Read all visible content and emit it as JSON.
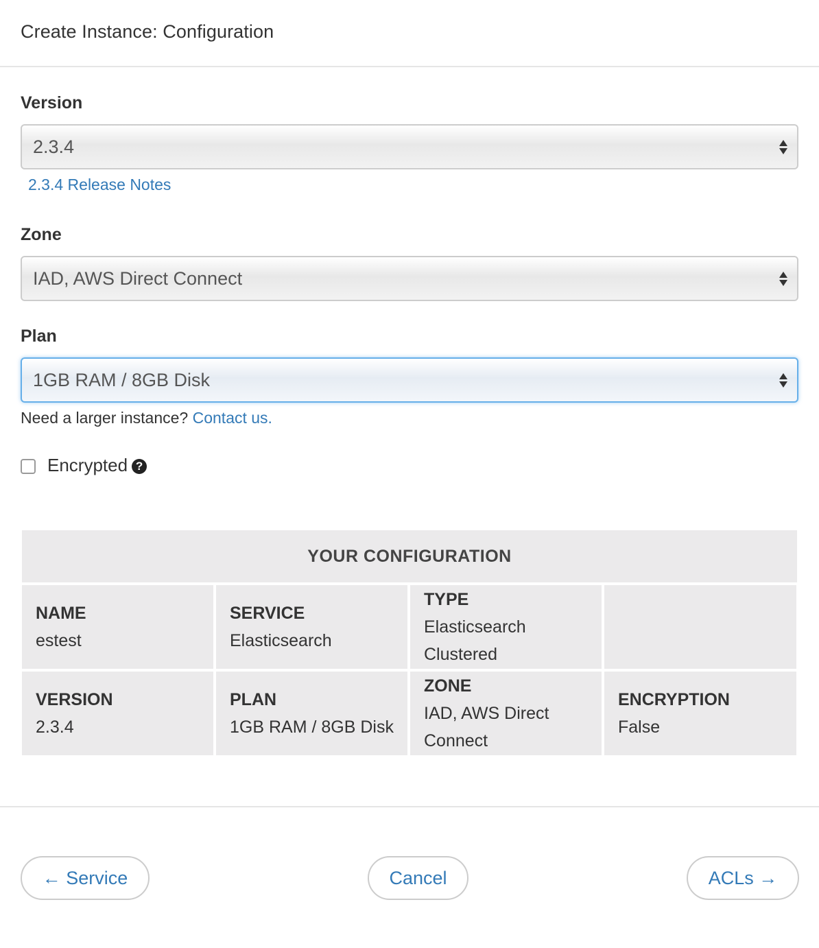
{
  "header": {
    "title": "Create Instance: Configuration"
  },
  "form": {
    "version": {
      "label": "Version",
      "value": "2.3.4",
      "release_notes_link": "2.3.4 Release Notes"
    },
    "zone": {
      "label": "Zone",
      "value": "IAD, AWS Direct Connect"
    },
    "plan": {
      "label": "Plan",
      "value": "1GB RAM / 8GB Disk",
      "hint": "Need a larger instance?",
      "contact_link": "Contact us."
    },
    "encrypted": {
      "label": "Encrypted",
      "checked": false,
      "help_icon": "question-circle-icon"
    }
  },
  "summary": {
    "title": "YOUR CONFIGURATION",
    "row1": [
      {
        "key": "NAME",
        "value": "estest"
      },
      {
        "key": "SERVICE",
        "value": "Elasticsearch"
      },
      {
        "key": "TYPE",
        "value": "Elasticsearch Clustered"
      },
      {
        "key": "",
        "value": ""
      }
    ],
    "row2": [
      {
        "key": "VERSION",
        "value": "2.3.4"
      },
      {
        "key": "PLAN",
        "value": "1GB RAM / 8GB Disk"
      },
      {
        "key": "ZONE",
        "value": "IAD, AWS Direct Connect"
      },
      {
        "key": "ENCRYPTION",
        "value": "False"
      }
    ]
  },
  "footer": {
    "back_label": "← Service",
    "cancel_label": "Cancel",
    "next_label": "ACLs →"
  }
}
